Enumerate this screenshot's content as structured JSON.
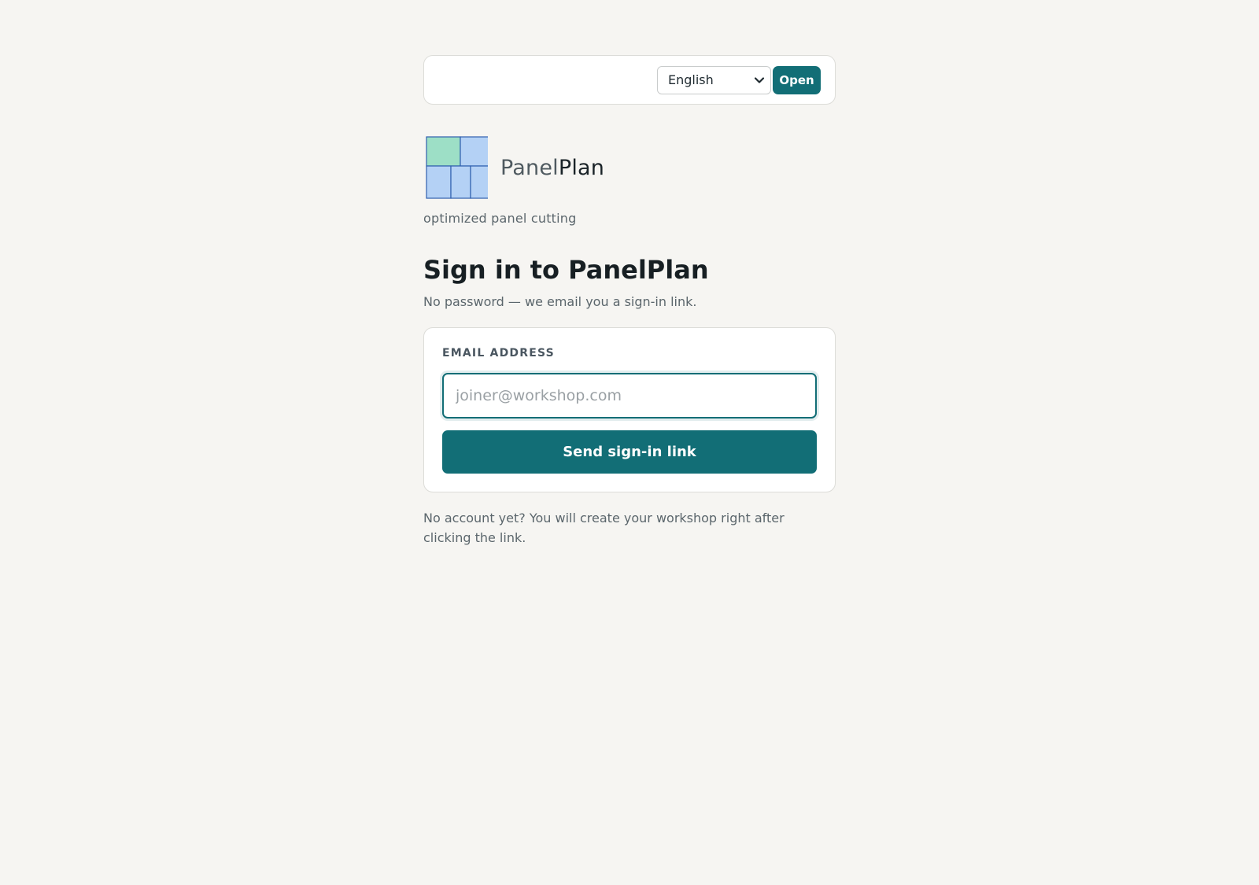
{
  "header": {
    "language_selected": "English",
    "open_label": "Open"
  },
  "brand": {
    "name_light": "Panel",
    "name_dark": "Plan",
    "logo_icon": "panel-layout-logo-icon",
    "tagline": "optimized panel cutting"
  },
  "signin": {
    "title": "Sign in to PanelPlan",
    "subtitle": "No password — we email you a sign-in link.",
    "email_label": "EMAIL ADDRESS",
    "email_placeholder": "joiner@workshop.com",
    "email_value": "",
    "submit_label": "Send sign-in link",
    "footnote": "No account yet? You will create your workshop right after clicking the link."
  },
  "colors": {
    "accent": "#126e76",
    "background": "#f6f5f2",
    "logo_green": "#9ddfc6",
    "logo_blue": "#b4d1f5",
    "logo_stroke": "#2f5fae"
  }
}
